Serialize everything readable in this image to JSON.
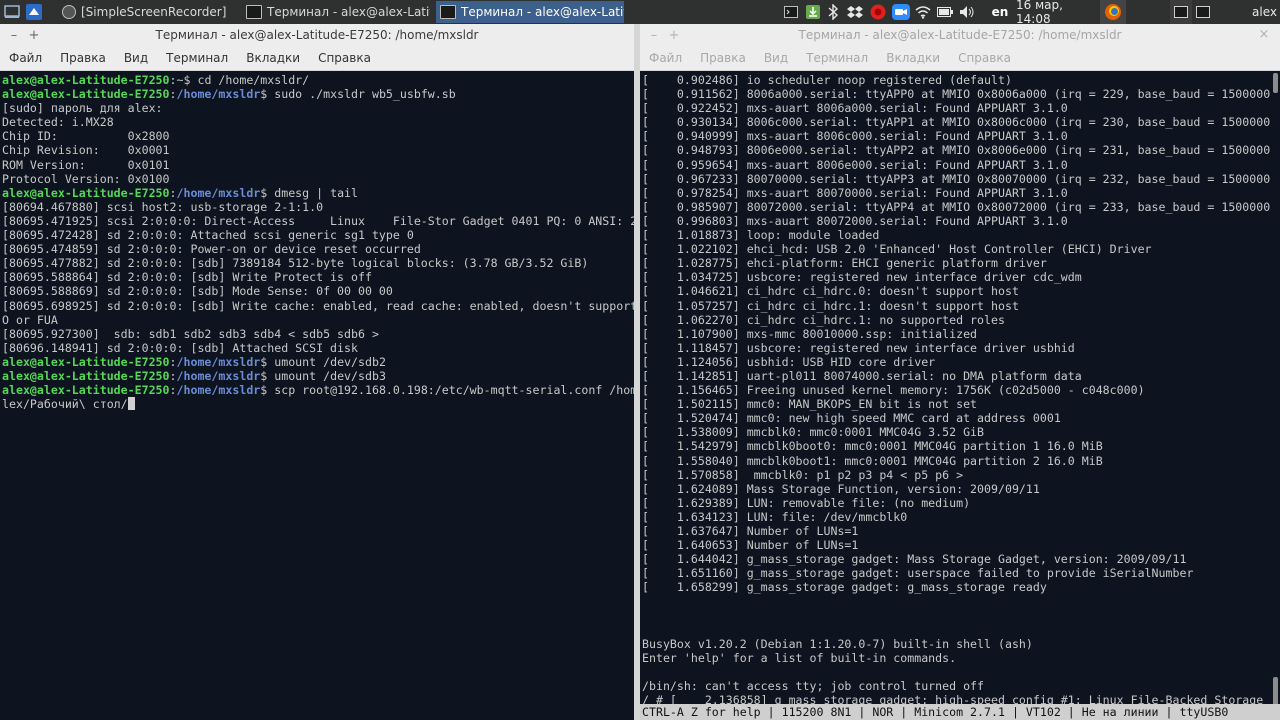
{
  "taskbar": {
    "tasks": [
      {
        "label": "[SimpleScreenRecorder]",
        "active": false
      },
      {
        "label": "Терминал - alex@alex-Latitu...",
        "active": false
      },
      {
        "label": "Терминал - alex@alex-Latitu...",
        "active": true
      }
    ],
    "lang": "en",
    "datetime": "16 мар, 14:08",
    "user": "alex"
  },
  "left_window": {
    "title": "Терминал - alex@alex-Latitude-E7250: /home/mxsldr",
    "menu": [
      "Файл",
      "Правка",
      "Вид",
      "Терминал",
      "Вкладки",
      "Справка"
    ],
    "user_host": "alex@alex-Latitude-E7250",
    "lines": [
      {
        "t": "prompt",
        "path": "~",
        "cmd": " cd /home/mxsldr/"
      },
      {
        "t": "prompt",
        "path": "/home/mxsldr",
        "cmd": " sudo ./mxsldr wb5_usbfw.sb"
      },
      {
        "t": "out",
        "text": "[sudo] пароль для alex:"
      },
      {
        "t": "out",
        "text": "Detected: i.MX28"
      },
      {
        "t": "out",
        "text": "Chip ID:          0x2800"
      },
      {
        "t": "out",
        "text": "Chip Revision:    0x0001"
      },
      {
        "t": "out",
        "text": "ROM Version:      0x0101"
      },
      {
        "t": "out",
        "text": "Protocol Version: 0x0100"
      },
      {
        "t": "prompt",
        "path": "/home/mxsldr",
        "cmd": " dmesg | tail"
      },
      {
        "t": "out",
        "text": "[80694.467880] scsi host2: usb-storage 2-1:1.0"
      },
      {
        "t": "out",
        "text": "[80695.471925] scsi 2:0:0:0: Direct-Access     Linux    File-Stor Gadget 0401 PQ: 0 ANSI: 2"
      },
      {
        "t": "out",
        "text": "[80695.472428] sd 2:0:0:0: Attached scsi generic sg1 type 0"
      },
      {
        "t": "out",
        "text": "[80695.474859] sd 2:0:0:0: Power-on or device reset occurred"
      },
      {
        "t": "out",
        "text": "[80695.477882] sd 2:0:0:0: [sdb] 7389184 512-byte logical blocks: (3.78 GB/3.52 GiB)"
      },
      {
        "t": "out",
        "text": "[80695.588864] sd 2:0:0:0: [sdb] Write Protect is off"
      },
      {
        "t": "out",
        "text": "[80695.588869] sd 2:0:0:0: [sdb] Mode Sense: 0f 00 00 00"
      },
      {
        "t": "out",
        "text": "[80695.698925] sd 2:0:0:0: [sdb] Write cache: enabled, read cache: enabled, doesn't support DP"
      },
      {
        "t": "out",
        "text": "O or FUA"
      },
      {
        "t": "out",
        "text": "[80695.927300]  sdb: sdb1 sdb2 sdb3 sdb4 < sdb5 sdb6 >"
      },
      {
        "t": "out",
        "text": "[80696.148941] sd 2:0:0:0: [sdb] Attached SCSI disk"
      },
      {
        "t": "prompt",
        "path": "/home/mxsldr",
        "cmd": " umount /dev/sdb2"
      },
      {
        "t": "prompt",
        "path": "/home/mxsldr",
        "cmd": " umount /dev/sdb3"
      },
      {
        "t": "prompt",
        "path": "/home/mxsldr",
        "cmd": " scp root@192.168.0.198:/etc/wb-mqtt-serial.conf /home/a"
      },
      {
        "t": "out",
        "text": "lex/Рабочий\\ стол/",
        "cursor": true
      }
    ]
  },
  "right_window": {
    "title": "Терминал - alex@alex-Latitude-E7250: /home/mxsldr",
    "menu": [
      "Файл",
      "Правка",
      "Вид",
      "Терминал",
      "Вкладки",
      "Справка"
    ],
    "lines": [
      "[    0.902486] io scheduler noop registered (default)",
      "[    0.911562] 8006a000.serial: ttyAPP0 at MMIO 0x8006a000 (irq = 229, base_baud = 1500000) il",
      "[    0.922452] mxs-auart 8006a000.serial: Found APPUART 3.1.0",
      "[    0.930134] 8006c000.serial: ttyAPP1 at MMIO 0x8006c000 (irq = 230, base_baud = 1500000) il",
      "[    0.940999] mxs-auart 8006c000.serial: Found APPUART 3.1.0",
      "[    0.948793] 8006e000.serial: ttyAPP2 at MMIO 0x8006e000 (irq = 231, base_baud = 1500000) il",
      "[    0.959654] mxs-auart 8006e000.serial: Found APPUART 3.1.0",
      "[    0.967233] 80070000.serial: ttyAPP3 at MMIO 0x80070000 (irq = 232, base_baud = 1500000) il",
      "[    0.978254] mxs-auart 80070000.serial: Found APPUART 3.1.0",
      "[    0.985907] 80072000.serial: ttyAPP4 at MMIO 0x80072000 (irq = 233, base_baud = 1500000) il",
      "[    0.996803] mxs-auart 80072000.serial: Found APPUART 3.1.0",
      "[    1.018873] loop: module loaded",
      "[    1.022102] ehci_hcd: USB 2.0 'Enhanced' Host Controller (EHCI) Driver",
      "[    1.028775] ehci-platform: EHCI generic platform driver",
      "[    1.034725] usbcore: registered new interface driver cdc_wdm",
      "[    1.046621] ci_hdrc ci_hdrc.0: doesn't support host",
      "[    1.057257] ci_hdrc ci_hdrc.1: doesn't support host",
      "[    1.062270] ci_hdrc ci_hdrc.1: no supported roles",
      "[    1.107900] mxs-mmc 80010000.ssp: initialized",
      "[    1.118457] usbcore: registered new interface driver usbhid",
      "[    1.124056] usbhid: USB HID core driver",
      "[    1.142851] uart-pl011 80074000.serial: no DMA platform data",
      "[    1.156465] Freeing unused kernel memory: 1756K (c02d5000 - c048c000)",
      "[    1.502115] mmc0: MAN_BKOPS_EN bit is not set",
      "[    1.520474] mmc0: new high speed MMC card at address 0001",
      "[    1.538009] mmcblk0: mmc0:0001 MMC04G 3.52 GiB",
      "[    1.542979] mmcblk0boot0: mmc0:0001 MMC04G partition 1 16.0 MiB",
      "[    1.558040] mmcblk0boot1: mmc0:0001 MMC04G partition 2 16.0 MiB",
      "[    1.570858]  mmcblk0: p1 p2 p3 p4 < p5 p6 >",
      "[    1.624089] Mass Storage Function, version: 2009/09/11",
      "[    1.629389] LUN: removable file: (no medium)",
      "[    1.634123] LUN: file: /dev/mmcblk0",
      "[    1.637647] Number of LUNs=1",
      "[    1.640653] Number of LUNs=1",
      "[    1.644042] g_mass_storage gadget: Mass Storage Gadget, version: 2009/09/11",
      "[    1.651160] g_mass_storage gadget: userspace failed to provide iSerialNumber",
      "[    1.658299] g_mass_storage gadget: g_mass_storage ready",
      "",
      "",
      "",
      "BusyBox v1.20.2 (Debian 1:1.20.0-7) built-in shell (ash)",
      "Enter 'help' for a list of built-in commands.",
      "",
      "/bin/sh: can't access tty; job control turned off",
      "/ # [    2.136858] g_mass_storage gadget: high-speed config #1: Linux File-Backed Storage",
      ""
    ],
    "statusbar": "CTRL-A Z for help | 115200 8N1 | NOR | Minicom 2.7.1 | VT102 | Не на линии | ttyUSB0"
  },
  "colors": {
    "term_bg": "#0d1420",
    "prompt_user": "#55d655",
    "prompt_path": "#6c8bd6",
    "taskbar_bg": "#2f3131",
    "active_task": "#3c5f8c"
  },
  "icons": {
    "taskbar_left": [
      "show-desktop-icon",
      "app-menu-icon"
    ],
    "tray": [
      "terminal-icon",
      "download-icon",
      "bluetooth-icon",
      "dropbox-icon",
      "record-icon",
      "zoom-icon",
      "wifi-icon",
      "volume-icon",
      "firefox-icon"
    ]
  }
}
